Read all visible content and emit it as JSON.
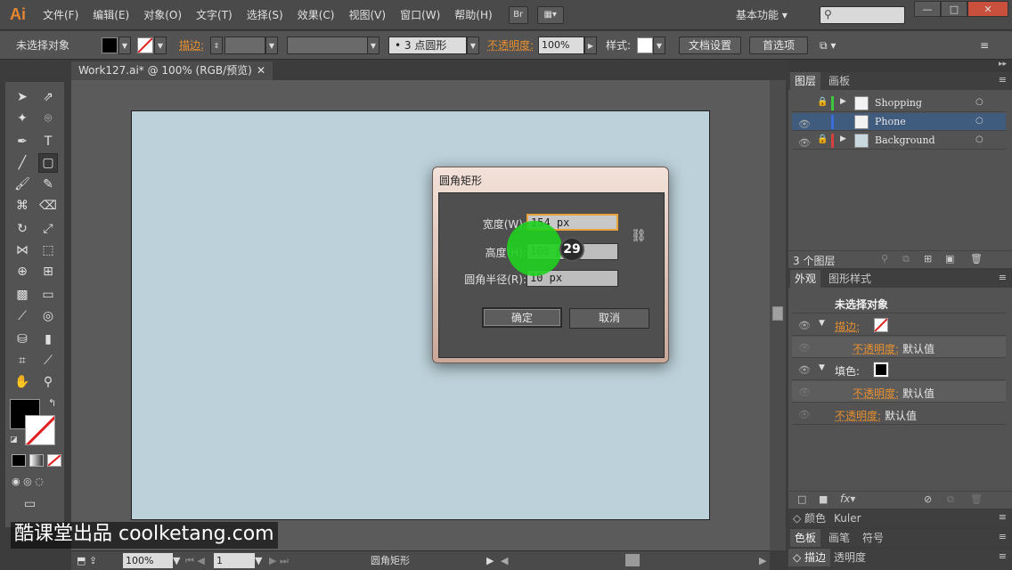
{
  "app": {
    "logo": "Ai",
    "menus": [
      "文件(F)",
      "编辑(E)",
      "对象(O)",
      "文字(T)",
      "选择(S)",
      "效果(C)",
      "视图(V)",
      "窗口(W)",
      "帮助(H)"
    ],
    "br_button": "Br",
    "workspace": "基本功能",
    "window_min": "—",
    "window_max": "□",
    "window_close": "✕"
  },
  "control_bar": {
    "selection_status": "未选择对象",
    "stroke_label": "描边:",
    "brush_value": "3 点圆形",
    "opacity_label": "不透明度:",
    "opacity_value": "100%",
    "style_label": "样式:",
    "doc_setup_button": "文档设置",
    "preferences_button": "首选项"
  },
  "document": {
    "tab_title": "Work127.ai* @ 100% (RGB/预览)",
    "tab_close": "✕"
  },
  "status_bar": {
    "zoom": "100%",
    "page": "1",
    "current_tool": "圆角矩形"
  },
  "dialog": {
    "title": "圆角矩形",
    "width_label": "宽度(W):",
    "width_value": "154 px",
    "height_label": "高度(H):",
    "height_value": "100 px",
    "radius_label": "圆角半径(R):",
    "radius_value": "10 px",
    "ok_button": "确定",
    "cancel_button": "取消"
  },
  "click_indicator": {
    "step": "29"
  },
  "layers_panel": {
    "tabs": [
      "图层",
      "画板"
    ],
    "layers": [
      {
        "name": "Shopping",
        "color": "#3cc83c",
        "locked": true
      },
      {
        "name": "Phone",
        "color": "#3c6cd8",
        "locked": false
      },
      {
        "name": "Background",
        "color": "#d84040",
        "locked": true
      }
    ],
    "count": "3 个图层"
  },
  "appearance_panel": {
    "tabs": [
      "外观",
      "图形样式"
    ],
    "heading": "未选择对象",
    "stroke_label": "描边:",
    "fill_label": "填色:",
    "opacity_label": "不透明度:",
    "default_value": "默认值"
  },
  "bottom_panels": {
    "row1": [
      "颜色",
      "Kuler"
    ],
    "row2": [
      "色板",
      "画笔",
      "符号"
    ],
    "row3": [
      "描边",
      "透明度"
    ]
  },
  "watermark": "酷课堂出品 coolketang.com",
  "colors": {
    "accent_orange": "#e8902f",
    "artboard": "#bcd1da",
    "selection_blue": "#3f5b7d",
    "click_green": "#1ed01e"
  }
}
